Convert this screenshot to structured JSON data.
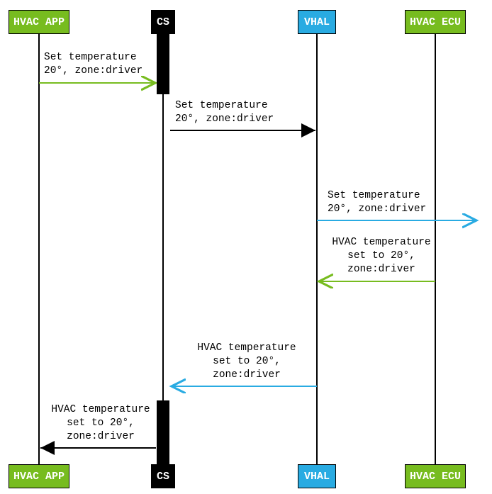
{
  "chart_data": {
    "type": "sequence-diagram",
    "participants": [
      {
        "id": "hvac_app",
        "label": "HVAC APP",
        "color": "#77bc1f"
      },
      {
        "id": "cs",
        "label": "CS",
        "color": "#000000"
      },
      {
        "id": "vhal",
        "label": "VHAL",
        "color": "#29abe2"
      },
      {
        "id": "hvac_ecu",
        "label": "HVAC ECU",
        "color": "#77bc1f"
      }
    ],
    "messages": [
      {
        "from": "hvac_app",
        "to": "cs",
        "color": "#77bc1f",
        "lines": [
          "Set temperature",
          "20°, zone:driver"
        ]
      },
      {
        "from": "cs",
        "to": "vhal",
        "color": "#000000",
        "lines": [
          "Set temperature",
          "20°, zone:driver"
        ]
      },
      {
        "from": "vhal",
        "to": "hvac_ecu",
        "color": "#29abe2",
        "lines": [
          "Set temperature",
          "20°, zone:driver"
        ]
      },
      {
        "from": "hvac_ecu",
        "to": "vhal",
        "color": "#77bc1f",
        "lines": [
          "HVAC temperature",
          "set to 20°,",
          "zone:driver"
        ]
      },
      {
        "from": "vhal",
        "to": "cs",
        "color": "#29abe2",
        "lines": [
          "HVAC temperature",
          "set to 20°,",
          "zone:driver"
        ]
      },
      {
        "from": "cs",
        "to": "hvac_app",
        "color": "#000000",
        "lines": [
          "HVAC temperature",
          "set to 20°,",
          "zone:driver"
        ]
      }
    ]
  },
  "participants": {
    "hvac_app": "HVAC APP",
    "cs": "CS",
    "vhal": "VHAL",
    "hvac_ecu": "HVAC ECU"
  },
  "msg1_l1": "Set temperature",
  "msg1_l2": "20°, zone:driver",
  "msg2_l1": "Set temperature",
  "msg2_l2": "20°, zone:driver",
  "msg3_l1": "Set temperature",
  "msg3_l2": "20°, zone:driver",
  "msg4_l1": "HVAC temperature",
  "msg4_l2": "set to 20°,",
  "msg4_l3": "zone:driver",
  "msg5_l1": "HVAC temperature",
  "msg5_l2": "set to 20°,",
  "msg5_l3": "zone:driver",
  "msg6_l1": "HVAC temperature",
  "msg6_l2": "set to 20°,",
  "msg6_l3": "zone:driver"
}
